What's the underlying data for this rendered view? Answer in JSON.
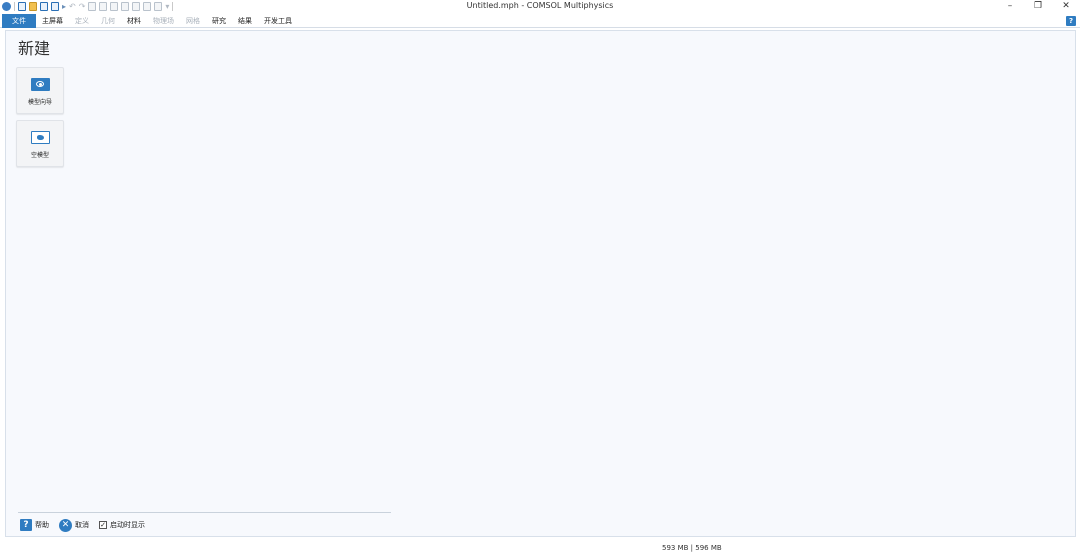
{
  "window": {
    "title": "Untitled.mph - COMSOL Multiphysics",
    "controls": {
      "minimize": "–",
      "restore": "❐",
      "close": "✕"
    }
  },
  "ribbon": {
    "tabs": [
      {
        "label": "文件",
        "state": "active"
      },
      {
        "label": "主屏幕",
        "state": "normal"
      },
      {
        "label": "定义",
        "state": "disabled"
      },
      {
        "label": "几何",
        "state": "disabled"
      },
      {
        "label": "材料",
        "state": "normal"
      },
      {
        "label": "物理场",
        "state": "disabled"
      },
      {
        "label": "网格",
        "state": "disabled"
      },
      {
        "label": "研究",
        "state": "normal"
      },
      {
        "label": "结果",
        "state": "normal"
      },
      {
        "label": "开发工具",
        "state": "normal"
      }
    ],
    "help_label": "?"
  },
  "main": {
    "title": "新建",
    "tiles": [
      {
        "label": "模型向导",
        "icon": "model-wizard-icon"
      },
      {
        "label": "空模型",
        "icon": "blank-model-icon"
      }
    ]
  },
  "footer": {
    "help_icon": "?",
    "help_label": "帮助",
    "cancel_icon": "✕",
    "cancel_label": "取消",
    "show_on_startup_label": "启动时显示",
    "show_on_startup_checked": true,
    "check_mark": "✓"
  },
  "statusbar": {
    "memory": "593 MB | 596 MB"
  },
  "colors": {
    "accent": "#2f7cc1",
    "content_bg": "#f7f9fd"
  }
}
